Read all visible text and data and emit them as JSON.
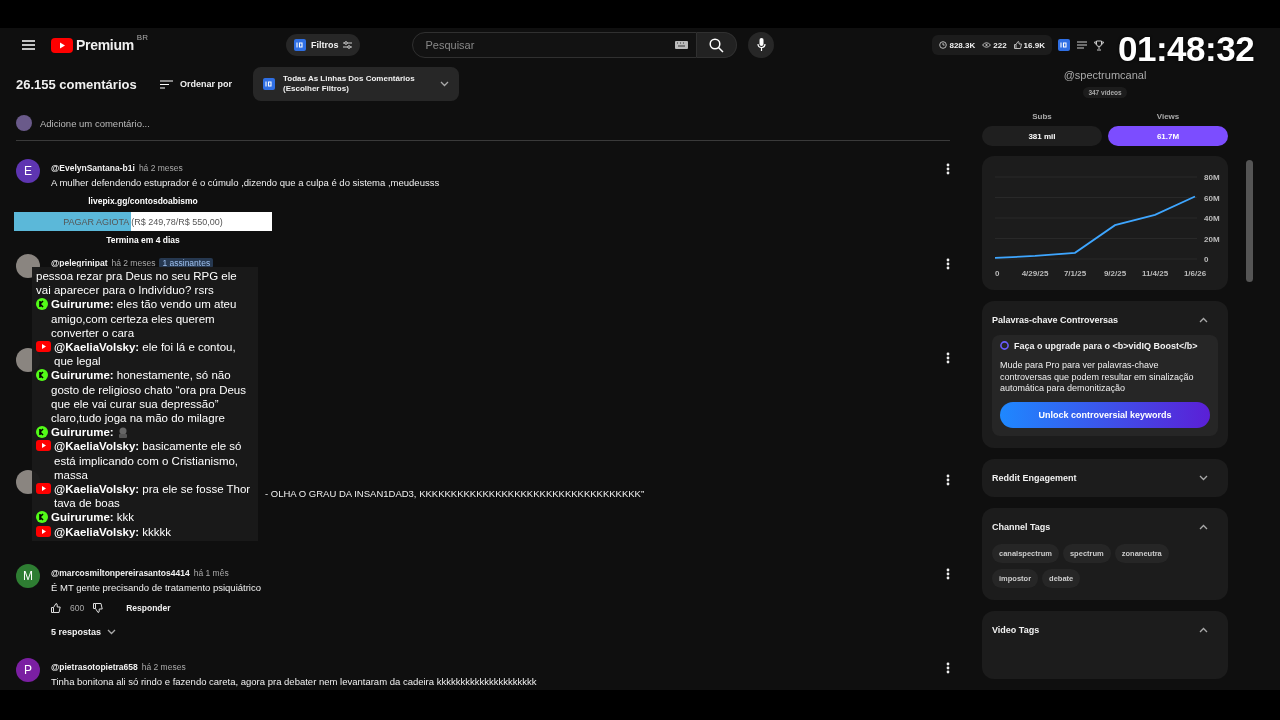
{
  "top_bar": {
    "logo_text": "Premium",
    "region": "BR",
    "filter_button": "Filtros",
    "search": {
      "placeholder": "Pesquisar"
    },
    "stats": [
      "828.3K",
      "222",
      "16.9K"
    ]
  },
  "clock": "01:48:32",
  "comments_header": {
    "count": "26.155 comentários",
    "sort": "Ordenar por",
    "filter": "Todas As Linhas Dos Comentários (Escolher Filtros)"
  },
  "add_comment": {
    "placeholder": "Adicione um comentário..."
  },
  "comments": [
    {
      "avatar": {
        "kind": "letter",
        "letter": "E",
        "color": "#5e35b1"
      },
      "author": "@EvelynSantana-b1i",
      "time": "há 2 meses",
      "text": "A mulher defendendo estuprador é o cúmulo ,dizendo que a culpa é do sistema ,meudeusss"
    },
    {
      "avatar": {
        "kind": "photo"
      },
      "author": "@pelegrinipat",
      "time": "há 2 meses",
      "badge": "1 assinantes"
    },
    {
      "avatar": {
        "kind": "photo"
      }
    },
    {
      "avatar": {
        "kind": "photo"
      },
      "text": "- OLHA O GRAU DA INSAN1DAD3, KKKKKKKKKKKKKKKKKKKKKKKKKKKKKKKKKKK”"
    },
    {
      "avatar": {
        "kind": "letter",
        "letter": "M",
        "color": "#2e7d32"
      },
      "author": "@marcosmiltonpereirasantos4414",
      "time": "há 1 mês",
      "text": "É MT gente precisando de tratamento psiquiátrico",
      "likes": "600",
      "reply": "Responder",
      "replies": "5 respostas"
    },
    {
      "avatar": {
        "kind": "letter",
        "letter": "P",
        "color": "#7b1fa2"
      },
      "author": "@pietrasotopietra658",
      "time": "há 2 meses",
      "text": "Tinha bonitona ali só rindo e fazendo careta, agora pra debater nem levantaram da cadeira kkkkkkkkkkkkkkkkkkkkk"
    }
  ],
  "donation_goal": {
    "link": "livepix.gg/contosdoabismo",
    "goal": "PAGAR AGIOTA (R$ 249,78/R$ 550,00)",
    "level": 0.454,
    "ends": "Termina em 4 dias"
  },
  "live_chat": [
    {
      "kind": "text",
      "text": "pessoa rezar pra Deus no seu RPG ele vai aparecer para o Indivíduo? rsrs"
    },
    {
      "kind": "kick",
      "author": "Guirurume:",
      "text": "eles tão vendo um ateu amigo,com certeza eles querem converter o cara"
    },
    {
      "kind": "youtube",
      "author": "@KaeliaVolsky:",
      "text": "ele foi lá e contou, que legal"
    },
    {
      "kind": "kick",
      "author": "Guirurume:",
      "text": "honestamente, só não gosto de religioso chato “ora pra Deus que ele vai curar sua depressão” claro,tudo joga na mão do milagre"
    },
    {
      "kind": "kick",
      "author": "Guirurume:",
      "emote": true
    },
    {
      "kind": "youtube",
      "author": "@KaeliaVolsky:",
      "text": "basicamente ele só está implicando com o Cristianismo, massa"
    },
    {
      "kind": "youtube",
      "author": "@KaeliaVolsky:",
      "text": "pra ele se fosse Thor tava de boas"
    },
    {
      "kind": "kick",
      "author": "Guirurume:",
      "text": "kkk"
    },
    {
      "kind": "youtube",
      "author": "@KaeliaVolsky:",
      "text": "kkkkk"
    }
  ],
  "side_panel": {
    "handle": "@spectrumcanal",
    "videos": "347 vídeos",
    "metrics": [
      {
        "label": "Subs",
        "value": "381 mil",
        "selected": false
      },
      {
        "label": "Views",
        "value": "61.7M",
        "selected": true
      }
    ],
    "chart_data": {
      "type": "line",
      "categories": [
        "0",
        "4/29/25",
        "7/1/25",
        "9/2/25",
        "11/4/25",
        "1/6/26"
      ],
      "values": [
        1,
        3,
        6,
        33,
        43,
        61
      ],
      "grid": true,
      "ylim": [
        0,
        80
      ],
      "yticks": [
        {
          "value": 0,
          "label": "0"
        },
        {
          "value": 20,
          "label": "20M"
        },
        {
          "value": 40,
          "label": "40M"
        },
        {
          "value": 60,
          "label": "60M"
        },
        {
          "value": 80,
          "label": "80M"
        }
      ]
    },
    "sections": [
      {
        "kind": "upgrade",
        "title": "Palavras-chave Controversas",
        "expanded": true,
        "upgrade_title": "Faça o upgrade para o <b>vidIQ Boost</b>",
        "upgrade_text": "Mude para Pro para ver palavras-chave controversas que podem resultar em sinalização automática para demonitização",
        "button": "Unlock controversial keywords"
      },
      {
        "kind": "plain",
        "title": "Reddit Engagement",
        "expanded": false
      },
      {
        "kind": "tags",
        "title": "Channel Tags",
        "expanded": true,
        "tags": [
          "canalspectrum",
          "spectrum",
          "zonaneutra",
          "impostor",
          "debate"
        ]
      },
      {
        "kind": "plain",
        "title": "Video Tags",
        "expanded": true
      }
    ]
  }
}
